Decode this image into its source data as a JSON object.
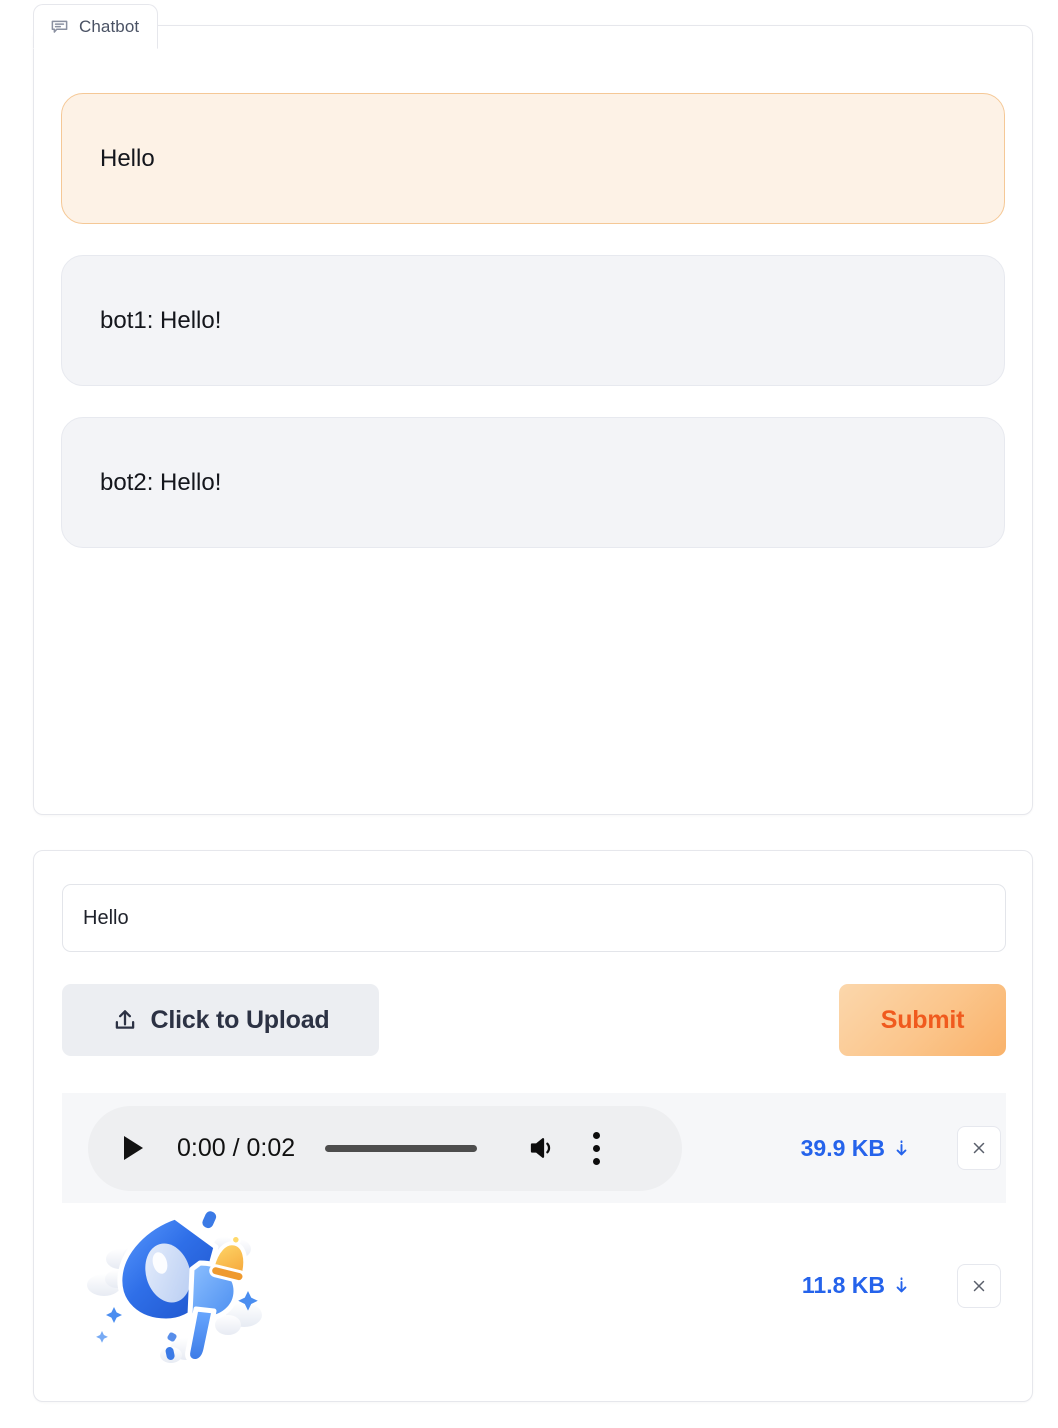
{
  "chatbot": {
    "tab_label": "Chatbot",
    "tab_icon": "chat-bubble-icon",
    "messages": [
      {
        "role": "user",
        "text": "Hello"
      },
      {
        "role": "bot",
        "text": "bot1: Hello!"
      },
      {
        "role": "bot",
        "text": "bot2: Hello!"
      }
    ]
  },
  "input_panel": {
    "textbox": {
      "value": "Hello",
      "placeholder": ""
    },
    "upload_button": {
      "label": "Click to Upload",
      "icon": "upload-icon"
    },
    "submit_button": {
      "label": "Submit"
    },
    "files": [
      {
        "type": "audio",
        "player": {
          "play_icon": "play-icon",
          "time": "0:00 / 0:02",
          "current_time": "0:00",
          "duration": "0:02",
          "volume_icon": "volume-icon",
          "menu_icon": "kebab-menu-icon"
        },
        "size": "39.9 KB",
        "download_icon": "download-icon",
        "remove_icon": "close-icon"
      },
      {
        "type": "image",
        "thumbnail": "megaphone-illustration",
        "size": "11.8 KB",
        "download_icon": "download-icon",
        "remove_icon": "close-icon"
      }
    ]
  },
  "colors": {
    "user_bubble_bg": "#fdf2e6",
    "user_bubble_border": "#f5c896",
    "bot_bubble_bg": "#f3f4f7",
    "bot_bubble_border": "#e7e9ef",
    "submit_text": "#f05a1e",
    "link_blue": "#2563eb",
    "panel_border": "#e6e7ec"
  }
}
